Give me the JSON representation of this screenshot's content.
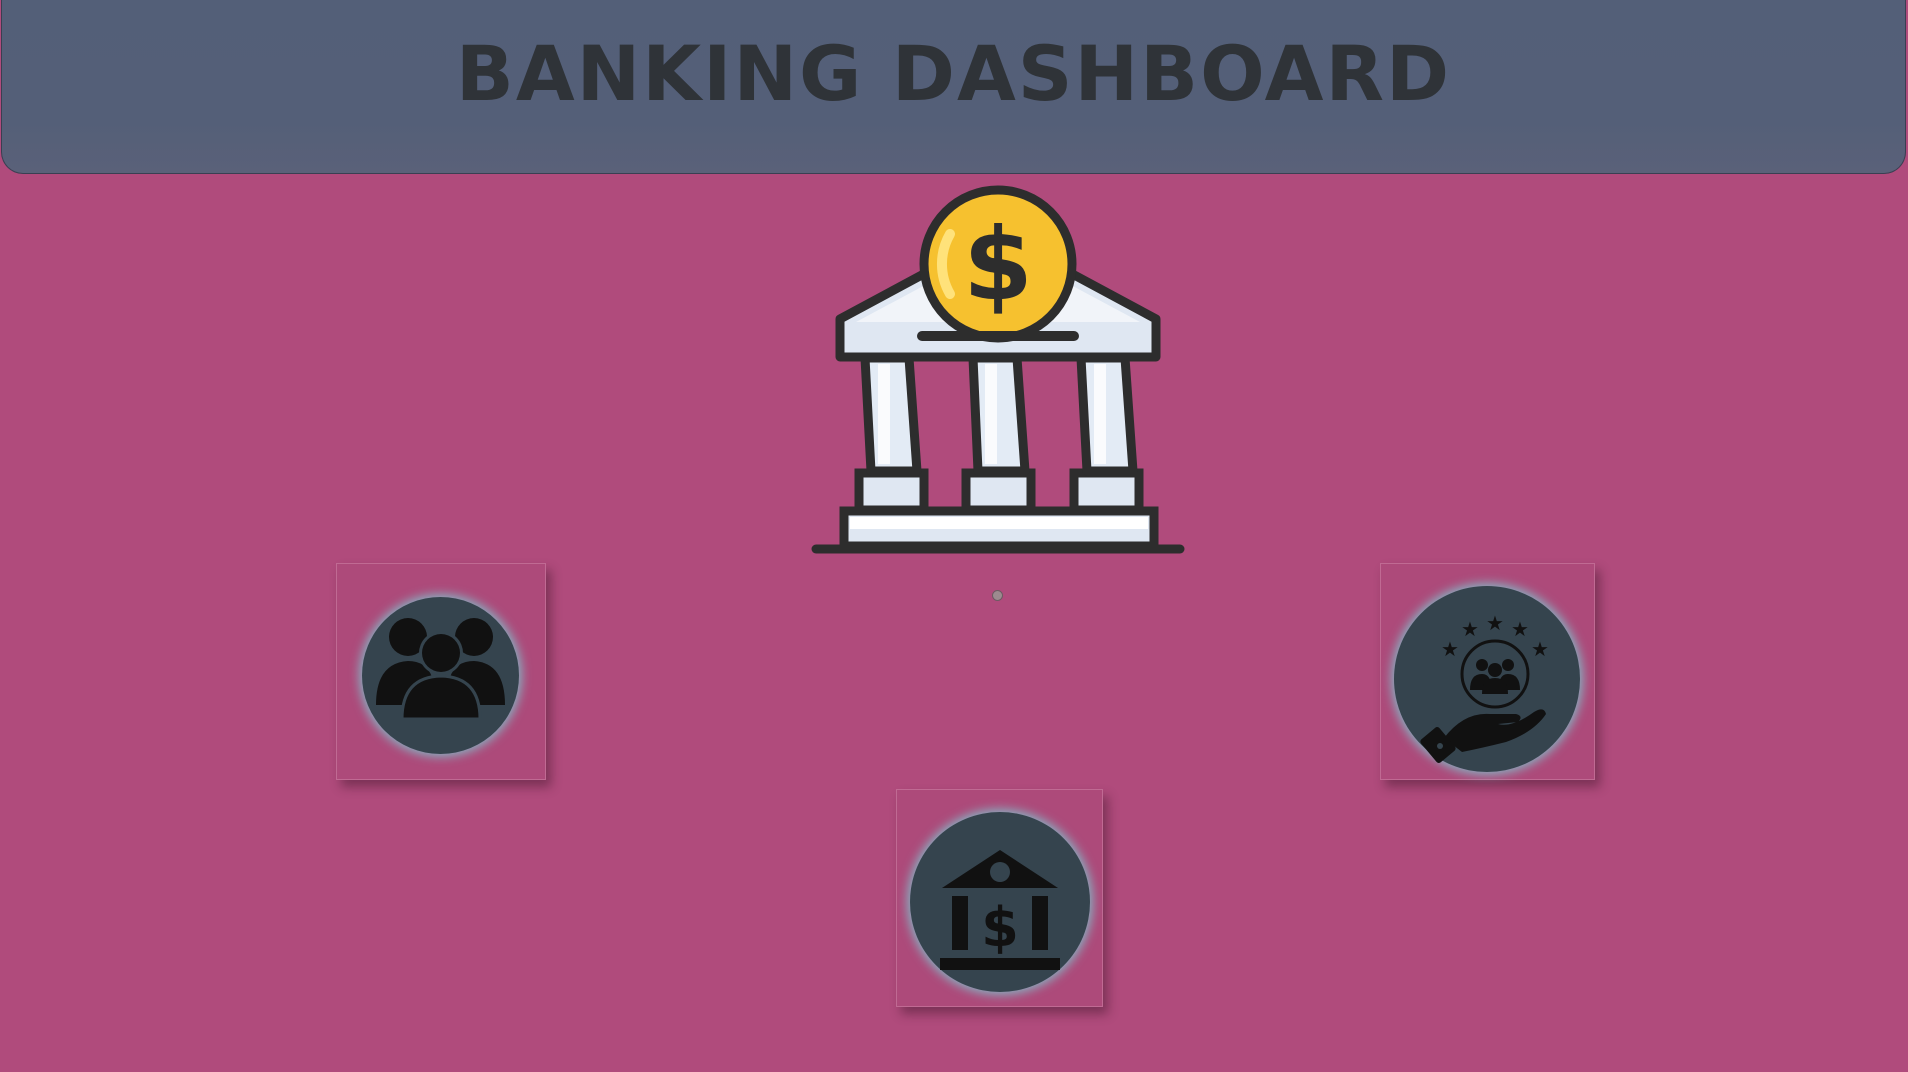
{
  "header": {
    "title": "BANKING DASHBOARD"
  },
  "hero": {
    "icon": "bank-building-dollar-coin-icon"
  },
  "nav_tiles": [
    {
      "icon": "customers-group-icon"
    },
    {
      "icon": "bank-dollar-icon"
    },
    {
      "icon": "customer-service-hand-stars-icon"
    }
  ],
  "colors": {
    "background": "#b04b7c",
    "header": "#545f78",
    "title_text": "#2f3338",
    "badge": "#35444e",
    "badge_glow": "#78d2d7",
    "coin": "#f6c12f"
  }
}
